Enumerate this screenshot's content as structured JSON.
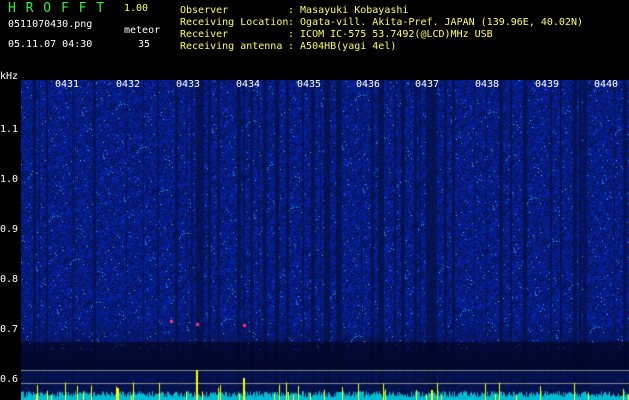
{
  "header": {
    "title": "H R O F F T",
    "version": "1.00",
    "filename": "0511070430.png",
    "meteor_label": "meteor",
    "timestamp": "05.11.07 04:30",
    "meteor_count": "35"
  },
  "info": [
    {
      "key": "Observer",
      "value": ": Masayuki Kobayashi"
    },
    {
      "key": "Receiving Location",
      "value": ": Ogata-vill. Akita-Pref. JAPAN (139.96E, 40.02N)"
    },
    {
      "key": "Receiver",
      "value": ": ICOM IC-575 53.7492(@LCD)MHz USB"
    },
    {
      "key": "Receiving antenna",
      "value": ": A504HB(yagi 4el)"
    }
  ],
  "axis": {
    "y_unit": "kHz",
    "y_ticks": [
      "1.1",
      "1.0",
      "0.9",
      "0.8",
      "0.7",
      "0.6"
    ],
    "x_ticks": [
      "0431",
      "0432",
      "0433",
      "0434",
      "0435",
      "0436",
      "0437",
      "0438",
      "0439",
      "0440"
    ]
  },
  "colors": {
    "background": "#000000",
    "spectrum_base": "#0a1a8c",
    "text_green": "#33ee33",
    "text_white": "#ffffff",
    "text_yellow": "#ffff55",
    "trace": "#ffff00",
    "baseline": "#00cccc"
  }
}
